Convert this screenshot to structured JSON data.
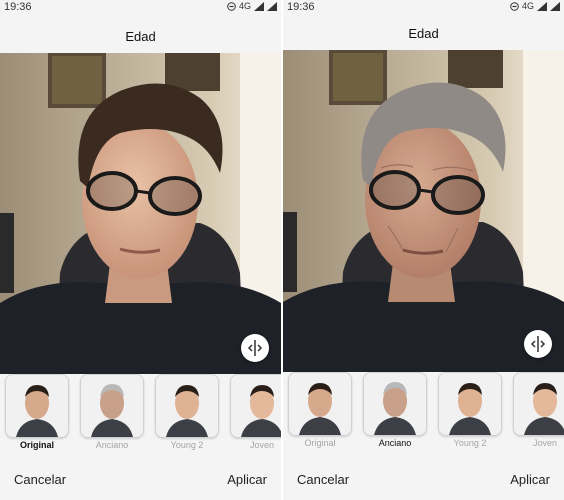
{
  "screens": [
    {
      "status": {
        "time": "19:36",
        "network": "4G"
      },
      "title": "Edad",
      "filters": [
        {
          "label": "Original",
          "selected": true
        },
        {
          "label": "Anciano",
          "selected": false
        },
        {
          "label": "Young 2",
          "selected": false
        },
        {
          "label": "Joven",
          "selected": false
        }
      ],
      "cancel_label": "Cancelar",
      "apply_label": "Aplicar"
    },
    {
      "status": {
        "time": "19:36",
        "network": "4G"
      },
      "title": "Edad",
      "filters": [
        {
          "label": "Original",
          "selected": false
        },
        {
          "label": "Anciano",
          "selected": true
        },
        {
          "label": "Young 2",
          "selected": false
        },
        {
          "label": "Joven",
          "selected": false
        }
      ],
      "cancel_label": "Cancelar",
      "apply_label": "Aplicar"
    }
  ]
}
